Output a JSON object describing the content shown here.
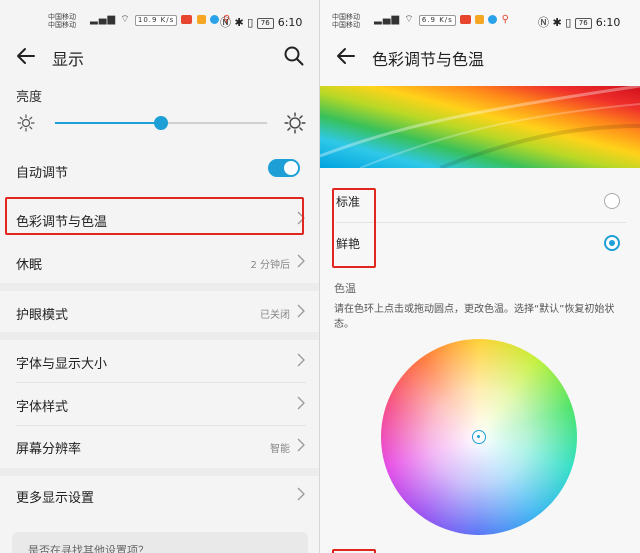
{
  "colors": {
    "accent": "#1e9fd6",
    "highlight_box": "#e0261e"
  },
  "left": {
    "status": {
      "carrier_top": "中国移动",
      "carrier_bottom": "中国移动",
      "speed": "10.9 K/s",
      "battery": "76",
      "time": "6:10"
    },
    "title": "显示",
    "back_icon": "back-arrow-icon",
    "search_icon": "search-icon",
    "brightness_label": "亮度",
    "brightness_level": 0.5,
    "auto_adjust": {
      "label": "自动调节",
      "on": true
    },
    "rows": [
      {
        "label": "色彩调节与色温",
        "value": ""
      },
      {
        "label": "休眠",
        "value": "2 分钟后"
      },
      {
        "label": "护眼模式",
        "value": "已关闭"
      },
      {
        "label": "字体与显示大小",
        "value": ""
      },
      {
        "label": "字体样式",
        "value": ""
      },
      {
        "label": "屏幕分辨率",
        "value": "智能"
      },
      {
        "label": "更多显示设置",
        "value": ""
      }
    ],
    "hint": "是否在寻找其他设置项？"
  },
  "right": {
    "status": {
      "carrier_top": "中国移动",
      "carrier_bottom": "中国移动",
      "speed": "6.9 K/s",
      "battery": "76",
      "time": "6:10"
    },
    "title": "色彩调节与色温",
    "modes": [
      {
        "label": "标准",
        "selected": false
      },
      {
        "label": "鲜艳",
        "selected": true
      }
    ],
    "temp_label": "色温",
    "temp_desc": "请在色环上点击或拖动圆点，更改色温。选择“默认”恢复初始状态。"
  }
}
